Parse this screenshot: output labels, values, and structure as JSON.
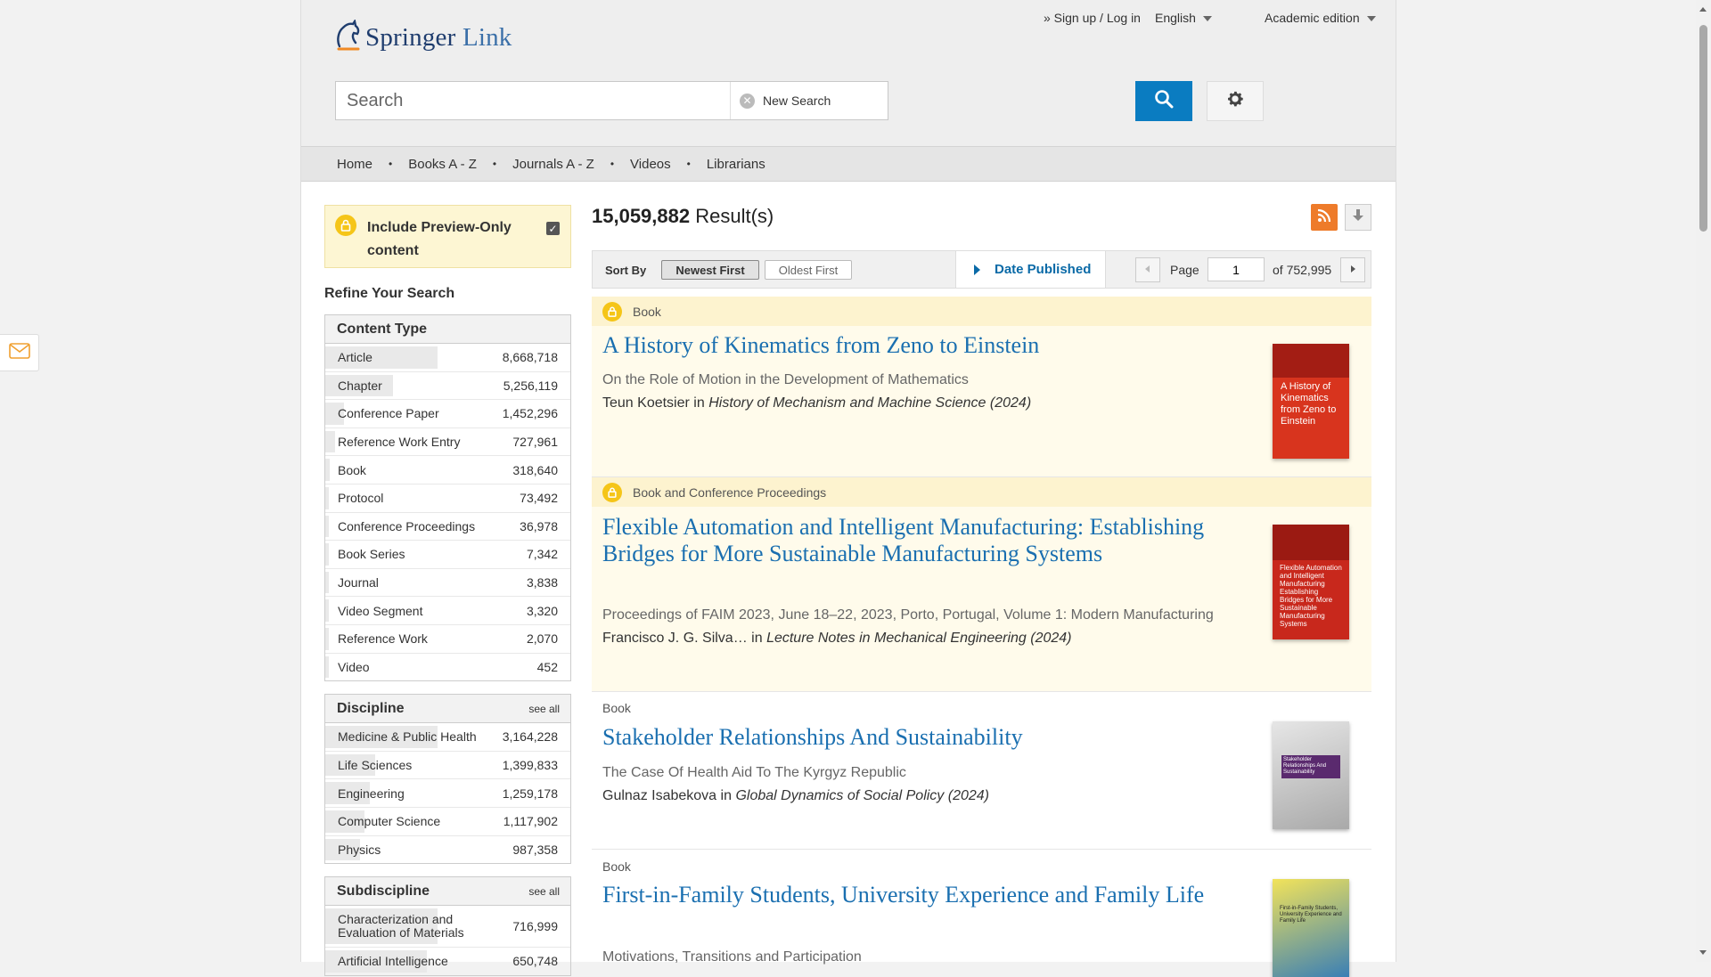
{
  "header": {
    "logo_main": "Springer",
    "logo_sub": "Link",
    "sign_in": "» Sign up / Log in",
    "language": "English",
    "edition": "Academic edition"
  },
  "search": {
    "placeholder": "Search",
    "new_search_label": "New Search"
  },
  "nav": {
    "items": [
      "Home",
      "Books A - Z",
      "Journals A - Z",
      "Videos",
      "Librarians"
    ]
  },
  "sidebar": {
    "preview_label": "Include Preview-Only content",
    "preview_checked": true,
    "refine_title": "Refine Your Search",
    "content_type": {
      "title": "Content Type",
      "items": [
        {
          "label": "Article",
          "count": "8,668,718",
          "fraction": 1.0
        },
        {
          "label": "Chapter",
          "count": "5,256,119",
          "fraction": 0.606
        },
        {
          "label": "Conference Paper",
          "count": "1,452,296",
          "fraction": 0.168
        },
        {
          "label": "Reference Work Entry",
          "count": "727,961",
          "fraction": 0.084
        },
        {
          "label": "Book",
          "count": "318,640",
          "fraction": 0.037
        },
        {
          "label": "Protocol",
          "count": "73,492",
          "fraction": 0.008
        },
        {
          "label": "Conference Proceedings",
          "count": "36,978",
          "fraction": 0.004
        },
        {
          "label": "Book Series",
          "count": "7,342",
          "fraction": 0.001
        },
        {
          "label": "Journal",
          "count": "3,838",
          "fraction": 0.0
        },
        {
          "label": "Video Segment",
          "count": "3,320",
          "fraction": 0.0
        },
        {
          "label": "Reference Work",
          "count": "2,070",
          "fraction": 0.0
        },
        {
          "label": "Video",
          "count": "452",
          "fraction": 0.0
        }
      ]
    },
    "discipline": {
      "title": "Discipline",
      "see_all": "see all",
      "items": [
        {
          "label": "Medicine & Public Health",
          "count": "3,164,228",
          "fraction": 1.0
        },
        {
          "label": "Life Sciences",
          "count": "1,399,833",
          "fraction": 0.442
        },
        {
          "label": "Engineering",
          "count": "1,259,178",
          "fraction": 0.398
        },
        {
          "label": "Computer Science",
          "count": "1,117,902",
          "fraction": 0.353
        },
        {
          "label": "Physics",
          "count": "987,358",
          "fraction": 0.312
        }
      ]
    },
    "subdiscipline": {
      "title": "Subdiscipline",
      "see_all": "see all",
      "items": [
        {
          "label": "Characterization and Evaluation of Materials",
          "count": "716,999",
          "fraction": 1.0
        },
        {
          "label": "Artificial Intelligence",
          "count": "650,748",
          "fraction": 0.908
        }
      ]
    }
  },
  "results": {
    "count": "15,059,882",
    "count_suffix": "Result(s)",
    "sort_label": "Sort By",
    "sort_newest": "Newest First",
    "sort_oldest": "Oldest First",
    "date_published": "Date Published",
    "page_label": "Page",
    "page_value": "1",
    "page_total": "of 752,995",
    "items": [
      {
        "type": "Book",
        "title": "A History of Kinematics from Zeno to Einstein",
        "subtitle": "On the Role of Motion in the Development of Mathematics",
        "authors": "Teun Koetsier",
        "in": "in",
        "source": "History of Mechanism and Machine Science (2024)",
        "cover_text": "A History of Kinematics from Zeno to Einstein",
        "cover_color": "#d8341e"
      },
      {
        "type": "Book and Conference Proceedings",
        "title": "Flexible Automation and Intelligent Manufacturing: Establishing Bridges for More Sustainable Manufacturing Systems",
        "subtitle": "Proceedings of FAIM 2023, June 18–22, 2023, Porto, Portugal, Volume 1: Modern Manufacturing",
        "authors": "Francisco J. G. Silva…",
        "in": "in",
        "source": "Lecture Notes in Mechanical Engineering (2024)",
        "cover_text": "Flexible Automation and Intelligent Manufacturing Establishing Bridges for More Sustainable Manufacturing Systems",
        "cover_color": "#c8281c"
      },
      {
        "type": "Book",
        "title": "Stakeholder Relationships And Sustainability",
        "subtitle": "The Case Of Health Aid To The Kyrgyz Republic",
        "authors": "Gulnaz Isabekova",
        "in": "in",
        "source": "Global Dynamics of Social Policy (2024)",
        "cover_text": "Stakeholder Relationships And Sustainability",
        "cover_color": "#bfbfbf"
      },
      {
        "type": "Book",
        "title": "First-in-Family Students, University Experience and Family Life",
        "subtitle": "Motivations, Transitions and Participation",
        "cover_text": "First-in-Family Students, University Experience and Family Life",
        "cover_color": "#e8d24a"
      }
    ]
  },
  "colors": {
    "accent_blue": "#0a7cc1",
    "title_blue": "#1a6fb0",
    "lock_yellow": "#f5c518",
    "rss_orange": "#ee7b2a"
  },
  "icons": [
    "springer-horse-icon",
    "clear-icon",
    "search-icon",
    "gear-icon",
    "lock-icon",
    "rss-icon",
    "download-icon",
    "prev-page-icon",
    "next-page-icon",
    "mail-icon"
  ]
}
